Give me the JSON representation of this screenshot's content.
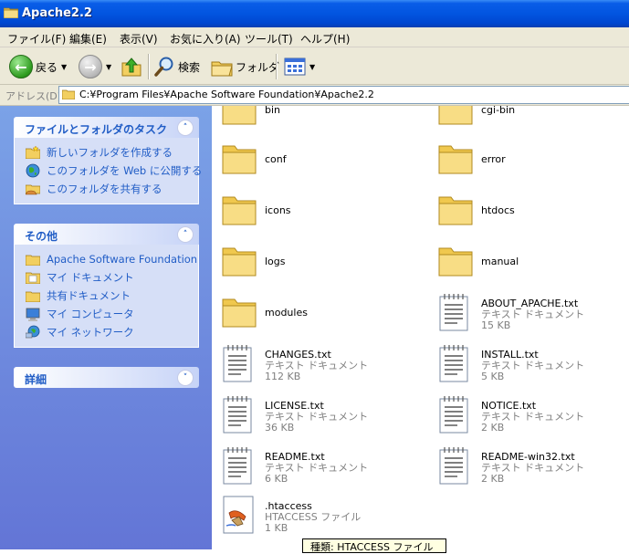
{
  "window": {
    "title": "Apache2.2"
  },
  "menu": [
    "ファイル(F)",
    "編集(E)",
    "表示(V)",
    "お気に入り(A)",
    "ツール(T)",
    "ヘルプ(H)"
  ],
  "toolbar": {
    "back_label": "戻る",
    "search_label": "検索",
    "folders_label": "フォルダ"
  },
  "address": {
    "label": "アドレス(D)",
    "path": "C:¥Program Files¥Apache Software Foundation¥Apache2.2"
  },
  "tasks_panel": {
    "title": "ファイルとフォルダのタスク",
    "items": [
      "新しいフォルダを作成する",
      "このフォルダを Web に公開する",
      "このフォルダを共有する"
    ]
  },
  "other_panel": {
    "title": "その他",
    "items": [
      "Apache Software Foundation",
      "マイ ドキュメント",
      "共有ドキュメント",
      "マイ コンピュータ",
      "マイ ネットワーク"
    ]
  },
  "details_panel": {
    "title": "詳細"
  },
  "files": [
    {
      "name": "bin",
      "kind": "folder"
    },
    {
      "name": "cgi-bin",
      "kind": "folder"
    },
    {
      "name": "conf",
      "kind": "folder"
    },
    {
      "name": "error",
      "kind": "folder"
    },
    {
      "name": "icons",
      "kind": "folder"
    },
    {
      "name": "htdocs",
      "kind": "folder"
    },
    {
      "name": "logs",
      "kind": "folder"
    },
    {
      "name": "manual",
      "kind": "folder"
    },
    {
      "name": "modules",
      "kind": "folder"
    },
    {
      "name": "ABOUT_APACHE.txt",
      "type": "テキスト ドキュメント",
      "size": "15 KB",
      "kind": "text"
    },
    {
      "name": "CHANGES.txt",
      "type": "テキスト ドキュメント",
      "size": "112 KB",
      "kind": "text"
    },
    {
      "name": "INSTALL.txt",
      "type": "テキスト ドキュメント",
      "size": "5 KB",
      "kind": "text"
    },
    {
      "name": "LICENSE.txt",
      "type": "テキスト ドキュメント",
      "size": "36 KB",
      "kind": "text"
    },
    {
      "name": "NOTICE.txt",
      "type": "テキスト ドキュメント",
      "size": "2 KB",
      "kind": "text"
    },
    {
      "name": "README.txt",
      "type": "テキスト ドキュメント",
      "size": "6 KB",
      "kind": "text"
    },
    {
      "name": "README-win32.txt",
      "type": "テキスト ドキュメント",
      "size": "2 KB",
      "kind": "text"
    },
    {
      "name": ".htaccess",
      "type": "HTACCESS ファイル",
      "size": "1 KB",
      "kind": "htaccess"
    }
  ],
  "tooltip": "種類: HTACCESS ファイル"
}
